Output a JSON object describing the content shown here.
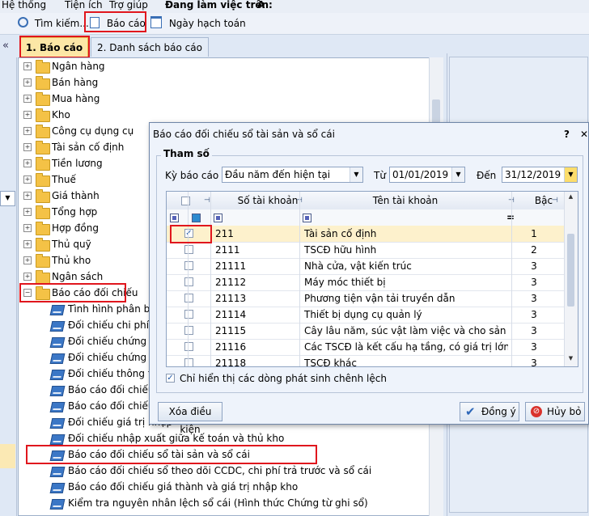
{
  "menu": {
    "items": [
      "Hệ thống",
      "Tiện ích",
      "Trợ giúp"
    ],
    "working_on_label": "Đang làm việc trên:",
    "working_on_value": "A"
  },
  "toolbar": {
    "search": "Tìm kiếm...",
    "report": "Báo cáo",
    "posting_date": "Ngày hạch toán"
  },
  "left": {
    "collapse": "«"
  },
  "tabs": [
    "1. Báo cáo",
    "2. Danh sách báo cáo"
  ],
  "tree": {
    "folders": [
      "Ngân hàng",
      "Bán hàng",
      "Mua hàng",
      "Kho",
      "Công cụ dụng cụ",
      "Tài sản cố định",
      "Tiền lương",
      "Thuế",
      "Giá thành",
      "Tổng hợp",
      "Hợp đồng",
      "Thủ quỹ",
      "Thủ kho",
      "Ngân sách",
      "Báo cáo đối chiếu"
    ],
    "reports": [
      "Tình hình phân bổ ch",
      "Đối chiếu chi phí mu",
      "Đối chiếu chứng từ c",
      "Đối chiếu chứng từ c",
      "Đối chiếu thông tin h",
      "Báo cáo đối chiếu bả",
      "Báo cáo đối chiếu kh",
      "Đối chiếu giá trị nhập",
      "Đối chiếu nhập xuất giữa kế toán và thủ kho",
      "Báo cáo đối chiếu sổ tài sản và sổ cái",
      "Báo cáo đối chiếu sổ theo dõi CCDC, chi phí trả trước và sổ cái",
      "Báo cáo đối chiếu giá thành và giá trị nhập kho",
      "Kiểm tra nguyên nhân lệch sổ cái (Hình thức Chứng từ ghi sổ)"
    ]
  },
  "dialog": {
    "title": "Báo cáo đối chiếu sổ tài sản và sổ cái",
    "help": "?",
    "close": "✕",
    "params_label": "Tham số",
    "period_label": "Kỳ báo cáo",
    "period_value": "Đầu năm đến hiện tại",
    "from_label": "Từ",
    "from_value": "01/01/2019",
    "to_label": "Đến",
    "to_value": "31/12/2019",
    "columns": {
      "account": "Số tài khoản",
      "name": "Tên tài khoản",
      "level": "Bậc"
    },
    "filter_eq": "=",
    "rows": [
      {
        "account": "211",
        "name": "Tài sản cố định",
        "level": "1",
        "checked": "✓"
      },
      {
        "account": "2111",
        "name": "TSCĐ hữu hình",
        "level": "2",
        "checked": ""
      },
      {
        "account": "21111",
        "name": "Nhà cửa, vật kiến trúc",
        "level": "3",
        "checked": ""
      },
      {
        "account": "21112",
        "name": "Máy móc thiết bị",
        "level": "3",
        "checked": ""
      },
      {
        "account": "21113",
        "name": "Phương tiện vận tải truyền dẫn",
        "level": "3",
        "checked": ""
      },
      {
        "account": "21114",
        "name": "Thiết bị dụng cụ quản lý",
        "level": "3",
        "checked": ""
      },
      {
        "account": "21115",
        "name": "Cây lâu năm, súc vật làm việc và cho sản phẩm",
        "level": "3",
        "checked": ""
      },
      {
        "account": "21116",
        "name": "Các TSCĐ là kết cấu hạ tầng, có giá trị lớn do...",
        "level": "3",
        "checked": ""
      },
      {
        "account": "21118",
        "name": "TSCĐ khác",
        "level": "3",
        "checked": ""
      }
    ],
    "only_changes_check": "✓",
    "only_changes_label": "Chỉ hiển thị các dòng phát sinh chênh lệch",
    "clear_button": "Xóa điều kiện",
    "ok_button": "Đồng ý",
    "cancel_button": "Hủy bỏ"
  }
}
